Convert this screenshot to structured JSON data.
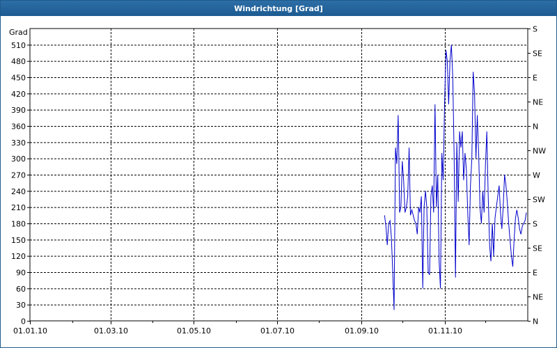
{
  "window": {
    "title": "Windrichtung [Grad]"
  },
  "chart_data": {
    "type": "line",
    "title": "Windrichtung [Grad]",
    "ylabel": "Grad",
    "ylim": [
      0,
      540
    ],
    "yticks": [
      0,
      30,
      60,
      90,
      120,
      150,
      180,
      210,
      240,
      270,
      300,
      330,
      360,
      390,
      420,
      450,
      480,
      510
    ],
    "right_axis_labels": [
      "N",
      "NE",
      "E",
      "SE",
      "S",
      "SW",
      "W",
      "NW",
      "N",
      "NE",
      "E",
      "SE",
      "S"
    ],
    "right_axis_values": [
      0,
      45,
      90,
      135,
      180,
      225,
      270,
      315,
      360,
      405,
      450,
      495,
      540
    ],
    "xticks": [
      "01.01.10",
      "01.03.10",
      "01.05.10",
      "01.07.10",
      "01.09.10",
      "01.11.10"
    ],
    "xtick_days": [
      0,
      59,
      120,
      181,
      243,
      304
    ],
    "xlim_days": [
      0,
      365
    ],
    "grid": true,
    "series": [
      {
        "color": "#0000cc",
        "x_days": [
          260,
          261,
          262,
          263,
          264,
          265,
          266,
          267,
          268,
          269,
          270,
          270.5,
          271,
          272,
          273,
          274,
          275,
          276,
          277,
          278,
          279,
          280,
          281,
          282,
          283,
          284,
          285,
          286,
          287,
          288,
          289,
          290,
          291,
          292,
          293,
          294,
          295,
          296,
          297,
          298,
          299,
          300,
          301,
          302,
          303,
          304,
          305,
          306,
          307,
          308,
          309,
          310,
          311,
          312,
          313,
          314,
          315,
          316,
          317,
          318,
          319,
          320,
          321,
          322,
          323,
          324,
          325,
          326,
          327,
          328,
          329,
          330,
          331,
          332,
          333,
          334,
          335,
          336,
          337,
          338,
          339,
          340,
          341,
          342,
          343,
          344,
          345,
          346,
          347,
          348,
          349,
          350,
          351,
          352,
          353,
          354,
          355,
          356,
          357,
          358,
          359,
          360,
          361,
          362,
          363,
          364
        ],
        "y": [
          195,
          175,
          140,
          180,
          185,
          155,
          90,
          20,
          320,
          290,
          380,
          300,
          200,
          210,
          295,
          260,
          200,
          210,
          230,
          320,
          195,
          205,
          195,
          185,
          180,
          160,
          210,
          200,
          230,
          60,
          210,
          240,
          210,
          90,
          85,
          230,
          250,
          200,
          400,
          210,
          270,
          110,
          60,
          310,
          260,
          400,
          500,
          480,
          400,
          480,
          510,
          450,
          310,
          80,
          330,
          220,
          350,
          320,
          350,
          260,
          310,
          280,
          200,
          140,
          250,
          300,
          460,
          420,
          300,
          380,
          310,
          210,
          180,
          240,
          200,
          290,
          350,
          230,
          140,
          110,
          180,
          120,
          190,
          210,
          230,
          250,
          200,
          170,
          210,
          270,
          250,
          220,
          180,
          150,
          120,
          100,
          150,
          190,
          205,
          190,
          170,
          160,
          175,
          180,
          185,
          200
        ]
      }
    ]
  }
}
